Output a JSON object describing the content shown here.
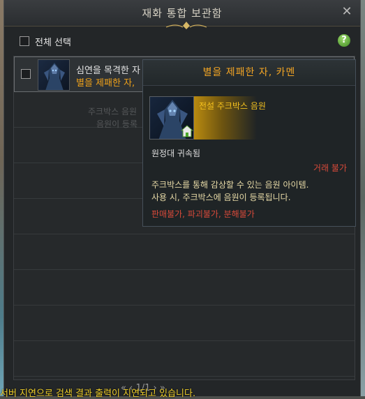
{
  "window": {
    "title": "재화 통합 보관함",
    "close_icon": "close-icon"
  },
  "toolbar": {
    "select_all_label": "전체 선택",
    "help_label": "?"
  },
  "list": {
    "items": [
      {
        "line1": "심연을 목격한 자",
        "line2": "별을 제패한 자,",
        "icon": "kamen-portrait"
      }
    ],
    "ghost_text_1": "주크박스 음원",
    "ghost_text_2": "음원이 등록"
  },
  "tooltip": {
    "title": "별을 제패한 자, 카멘",
    "grade": "전설 주크박스 음원",
    "bound": "원정대 귀속됨",
    "trade": "거래 불가",
    "desc_line1": "주크박스를 통해 감상할 수 있는 음원 아이템.",
    "desc_line2": "사용 시, 주크박스에 음원이 등록됩니다.",
    "restrictions": "판매불가, 파괴불가, 분해불가"
  },
  "footer": {
    "message": "서버 지연으로 검색 결과 출력이 지연되고 있습니다.",
    "page": "1/1"
  },
  "colors": {
    "accent_orange": "#f3a524",
    "legendary_gold": "#f3c01e",
    "warning_red": "#d94a3a"
  }
}
